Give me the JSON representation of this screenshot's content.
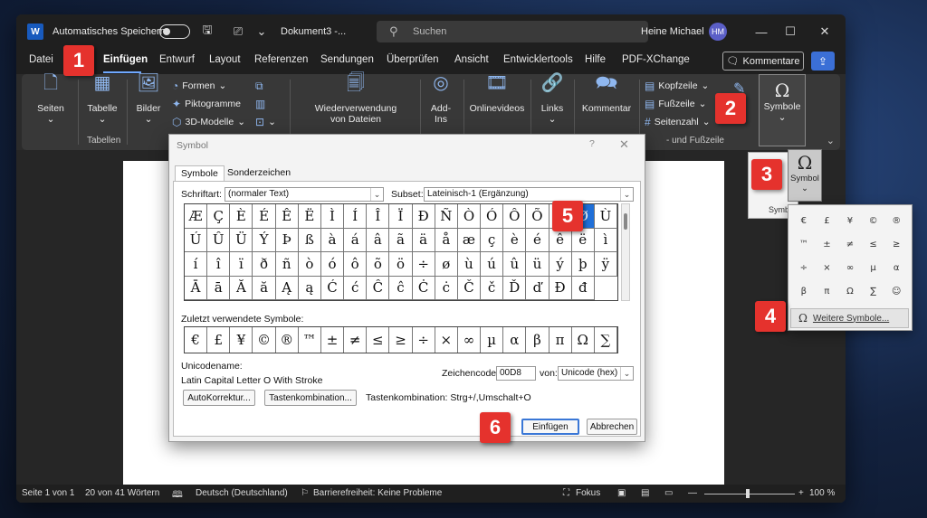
{
  "titlebar": {
    "autosave_label": "Automatisches Speichern",
    "doc_title": "Dokument3 -...",
    "search_placeholder": "Suchen",
    "user_name": "Heine Michael",
    "user_initials": "HM"
  },
  "menu": {
    "items": [
      "Datei",
      "Einfügen",
      "Entwurf",
      "Layout",
      "Referenzen",
      "Sendungen",
      "Überprüfen",
      "Ansicht",
      "Entwicklertools",
      "Hilfe",
      "PDF-XChange"
    ],
    "active": "Einfügen",
    "comments_label": "Kommentare"
  },
  "ribbon": {
    "seiten": "Seiten",
    "tabelle": "Tabelle",
    "tabellen_group": "Tabellen",
    "bilder": "Bilder",
    "formen": "Formen",
    "piktogramme": "Piktogramme",
    "modelle": "3D-Modelle",
    "wiederverwendung": "Wiederverwendung",
    "von_dateien": "von Dateien",
    "addins1": "Add-",
    "addins2": "Ins",
    "onlinevideos": "Onlinevideos",
    "links": "Links",
    "kommentar": "Kommentar",
    "kopfzeile": "Kopfzeile",
    "fusszeile": "Fußzeile",
    "seitenzahl": "Seitenzahl",
    "kopf_group": "- und Fußzeile",
    "symbole": "Symbole",
    "symbol_group_short": "Symb"
  },
  "dialog": {
    "title": "Symbol",
    "help": "?",
    "tabs": [
      "Symbole",
      "Sonderzeichen"
    ],
    "schriftart_label": "Schriftart:",
    "schriftart_value": "(normaler Text)",
    "subset_label": "Subset:",
    "subset_value": "Lateinisch-1 (Ergänzung)",
    "grid": [
      [
        "Æ",
        "Ç",
        "È",
        "É",
        "Ê",
        "Ë",
        "Ì",
        "Í",
        "Î",
        "Ï",
        "Ð",
        "Ñ",
        "Ò",
        "Ó",
        "Ô",
        "Õ",
        "Ö",
        "Ø"
      ],
      [
        "Ù",
        "Ú",
        "Û",
        "Ü",
        "Ý",
        "Þ",
        "ß",
        "à",
        "á",
        "â",
        "ã",
        "ä",
        "å",
        "æ",
        "ç",
        "è",
        "é",
        "ê",
        "ë"
      ],
      [
        "ì",
        "í",
        "î",
        "ï",
        "ð",
        "ñ",
        "ò",
        "ó",
        "ô",
        "õ",
        "ö",
        "÷",
        "ø",
        "ù",
        "ú",
        "û",
        "ü",
        "ý",
        "þ"
      ],
      [
        "ÿ",
        "Ā",
        "ā",
        "Ă",
        "ă",
        "Ą",
        "ą",
        "Ć",
        "ć",
        "Ĉ",
        "ĉ",
        "Ċ",
        "ċ",
        "Č",
        "č",
        "Ď",
        "ď",
        "Đ",
        "đ"
      ]
    ],
    "selected_symbol": "Ø",
    "recent_label": "Zuletzt verwendete Symbole:",
    "recent": [
      "€",
      "£",
      "¥",
      "©",
      "®",
      "™",
      "±",
      "≠",
      "≤",
      "≥",
      "÷",
      "×",
      "∞",
      "µ",
      "α",
      "β",
      "π",
      "Ω",
      "∑"
    ],
    "unicode_label": "Unicodename:",
    "unicode_name": "Latin Capital Letter O With Stroke",
    "zeichencode_label": "Zeichencode:",
    "zeichencode_value": "00D8",
    "von_label": "von:",
    "von_value": "Unicode (hex)",
    "autokorrektur": "AutoKorrektur...",
    "tastenkombination_btn": "Tastenkombination...",
    "tastenkombination_text": "Tastenkombination: Strg+/,Umschalt+O",
    "einfuegen": "Einfügen",
    "abbrechen": "Abbrechen"
  },
  "flyout": {
    "symbol_label": "Symbol",
    "symbols": [
      "€",
      "£",
      "¥",
      "©",
      "®",
      "™",
      "±",
      "≠",
      "≤",
      "≥",
      "÷",
      "×",
      "∞",
      "µ",
      "α",
      "β",
      "π",
      "Ω",
      "∑",
      "☺"
    ],
    "more": "Weitere Symbole..."
  },
  "status": {
    "page": "Seite 1 von 1",
    "words": "20 von 41 Wörtern",
    "language": "Deutsch (Deutschland)",
    "accessibility": "Barrierefreiheit: Keine Probleme",
    "focus": "Fokus",
    "zoom": "100 %"
  },
  "badges": [
    "1",
    "2",
    "3",
    "4",
    "5",
    "6"
  ],
  "colors": {
    "accent": "#1f6fd8",
    "badge": "#e5322d",
    "word_blue": "#185abd"
  }
}
